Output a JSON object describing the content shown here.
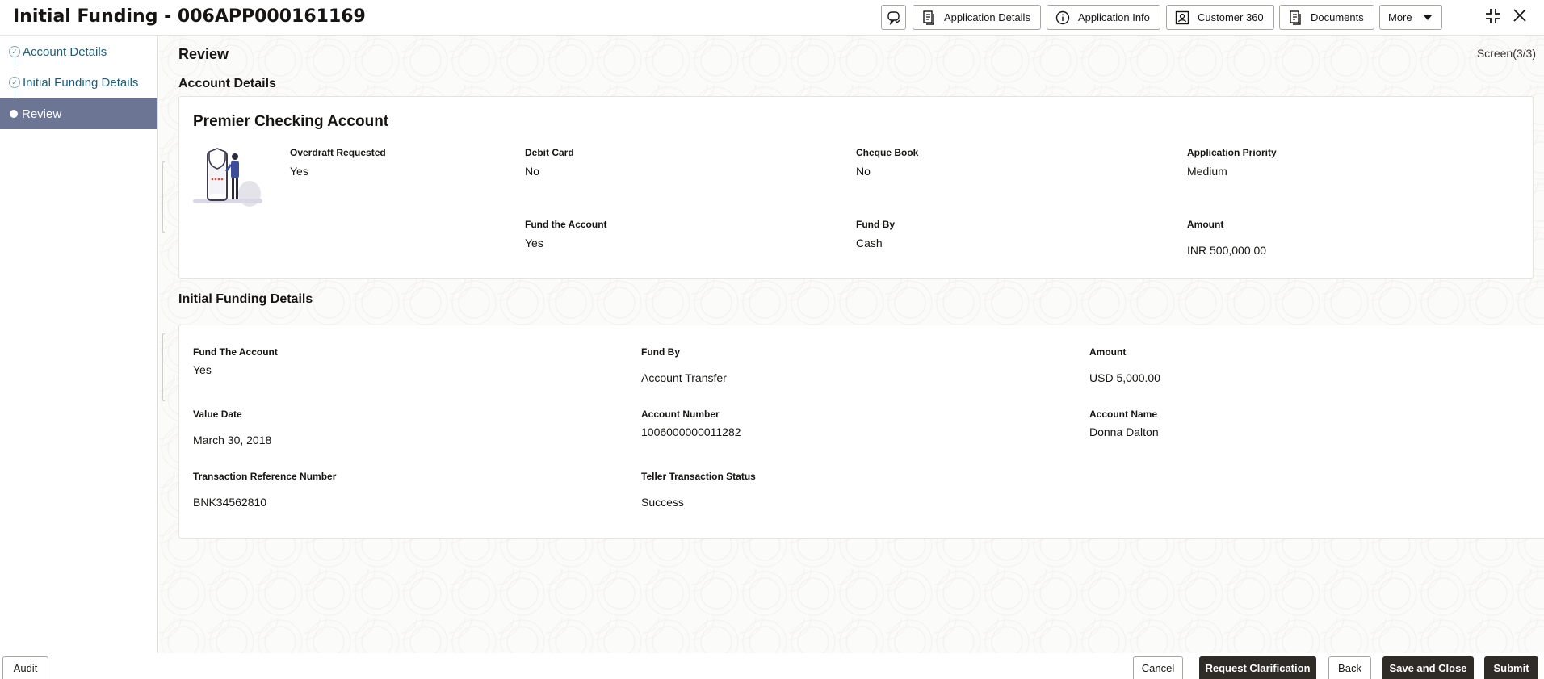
{
  "header": {
    "title": "Initial Funding - 006APP000161169",
    "buttons": {
      "application_details": "Application Details",
      "application_info": "Application Info",
      "customer_360": "Customer 360",
      "documents": "Documents",
      "more": "More"
    }
  },
  "sidebar": {
    "steps": [
      {
        "label": "Account Details",
        "state": "done"
      },
      {
        "label": "Initial Funding Details",
        "state": "done"
      },
      {
        "label": "Review",
        "state": "active"
      }
    ]
  },
  "main": {
    "title": "Review",
    "screen_indicator": "Screen(3/3)",
    "account_section": {
      "heading": "Account Details",
      "account_name": "Premier Checking Account",
      "fields": {
        "overdraft_requested": {
          "label": "Overdraft Requested",
          "value": "Yes"
        },
        "debit_card": {
          "label": "Debit Card",
          "value": "No"
        },
        "cheque_book": {
          "label": "Cheque Book",
          "value": "No"
        },
        "application_priority": {
          "label": "Application Priority",
          "value": "Medium"
        },
        "fund_the_account": {
          "label": "Fund the Account",
          "value": "Yes"
        },
        "fund_by": {
          "label": "Fund By",
          "value": "Cash"
        },
        "amount": {
          "label": "Amount",
          "value": "INR 500,000.00"
        }
      }
    },
    "funding_section": {
      "heading": "Initial Funding Details",
      "fields": {
        "fund_the_account": {
          "label": "Fund The Account",
          "value": "Yes"
        },
        "fund_by": {
          "label": "Fund By",
          "value": "Account Transfer"
        },
        "amount": {
          "label": "Amount",
          "value": "USD 5,000.00"
        },
        "value_date": {
          "label": "Value Date",
          "value": "March 30, 2018"
        },
        "account_number": {
          "label": "Account Number",
          "value": "1006000000011282"
        },
        "account_name": {
          "label": "Account Name",
          "value": "Donna Dalton"
        },
        "txn_ref": {
          "label": "Transaction Reference Number",
          "value": "BNK34562810"
        },
        "teller_status": {
          "label": "Teller Transaction Status",
          "value": "Success"
        }
      }
    }
  },
  "footer": {
    "audit": "Audit",
    "cancel": "Cancel",
    "request_clarification": "Request Clarification",
    "back": "Back",
    "save_and_close": "Save and Close",
    "submit": "Submit"
  },
  "colors": {
    "accent_active_step": "#6c7594",
    "link_step": "#1c5e77",
    "primary_button": "#2f2b27"
  }
}
